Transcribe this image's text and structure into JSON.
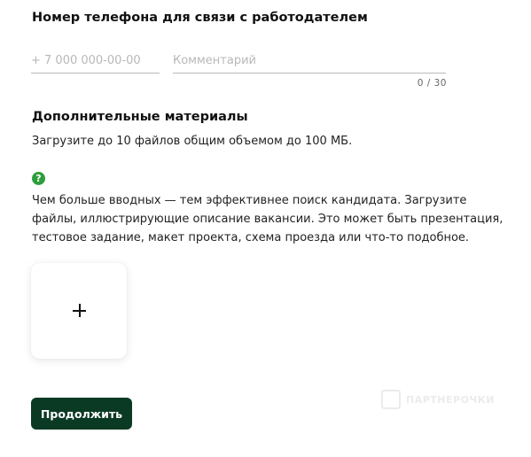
{
  "contact": {
    "title": "Номер телефона для связи с работодателем",
    "phone_placeholder": "+ 7 000 000-00-00",
    "comment_placeholder": "Комментарий",
    "counter": "0 / 30"
  },
  "materials": {
    "title": "Дополнительные материалы",
    "subtitle": "Загрузите до 10 файлов общим объемом до 100 МБ.",
    "help_icon_glyph": "?",
    "description": "Чем больше вводных — тем эффективнее поиск кандидата. Загрузите файлы, иллюстрирующие описание вакансии. Это может быть презентация, тестовое задание, макет проекта, схема проезда или что-то подобное."
  },
  "watermark": {
    "text": "ПАРТНЕРОЧКИ"
  },
  "actions": {
    "continue_label": "Продолжить"
  },
  "colors": {
    "primary_button": "#0b3a24",
    "help_icon": "#2e9e3c"
  },
  "icons": {
    "help": "question-circle-icon",
    "upload": "plus-icon"
  }
}
